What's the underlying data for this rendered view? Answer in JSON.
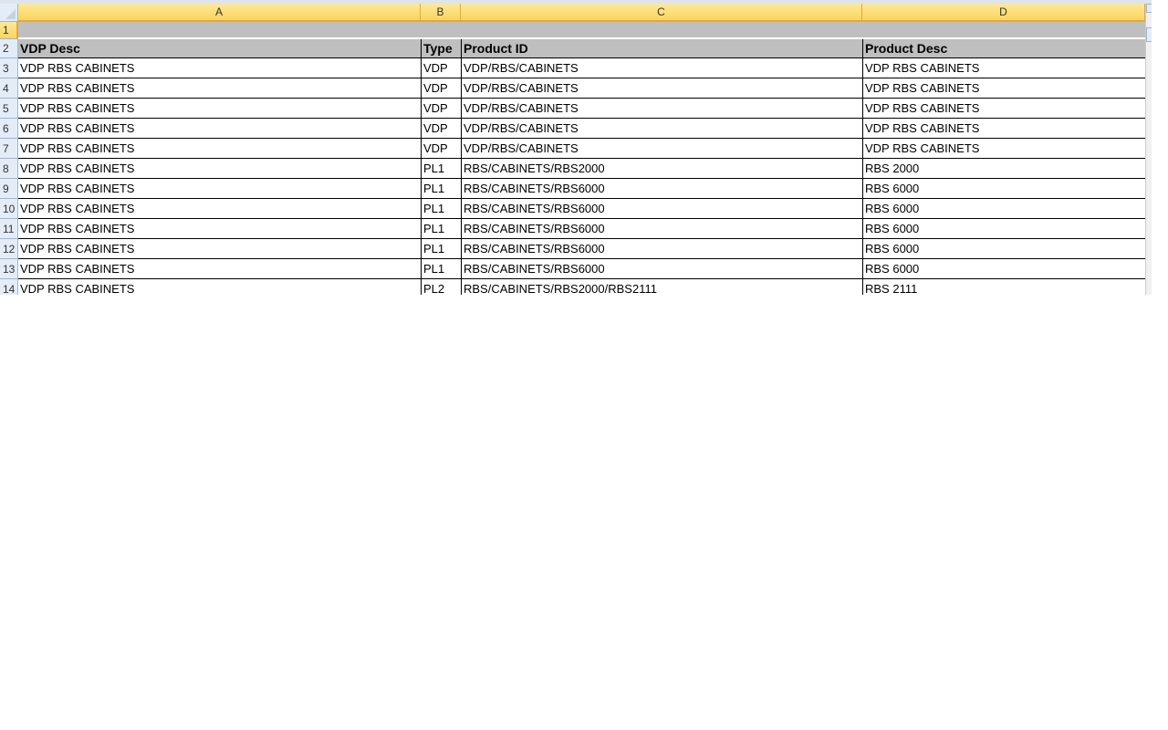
{
  "columns": [
    "A",
    "B",
    "C",
    "D"
  ],
  "row_numbers": [
    "1",
    "2",
    "3",
    "4",
    "5",
    "6",
    "7",
    "8",
    "9",
    "10",
    "11",
    "12",
    "13",
    "14"
  ],
  "header": [
    "VDP Desc",
    "Type",
    "Product ID",
    "Product Desc"
  ],
  "rows": [
    [
      "VDP RBS CABINETS",
      "VDP",
      "VDP/RBS/CABINETS",
      "VDP RBS CABINETS"
    ],
    [
      "VDP RBS CABINETS",
      "VDP",
      "VDP/RBS/CABINETS",
      "VDP RBS CABINETS"
    ],
    [
      "VDP RBS CABINETS",
      "VDP",
      "VDP/RBS/CABINETS",
      "VDP RBS CABINETS"
    ],
    [
      "VDP RBS CABINETS",
      "VDP",
      "VDP/RBS/CABINETS",
      "VDP RBS CABINETS"
    ],
    [
      "VDP RBS CABINETS",
      "VDP",
      "VDP/RBS/CABINETS",
      "VDP RBS CABINETS"
    ],
    [
      "VDP RBS CABINETS",
      "PL1",
      "RBS/CABINETS/RBS2000",
      "RBS 2000"
    ],
    [
      "VDP RBS CABINETS",
      "PL1",
      "RBS/CABINETS/RBS6000",
      "RBS 6000"
    ],
    [
      "VDP RBS CABINETS",
      "PL1",
      "RBS/CABINETS/RBS6000",
      "RBS 6000"
    ],
    [
      "VDP RBS CABINETS",
      "PL1",
      "RBS/CABINETS/RBS6000",
      "RBS 6000"
    ],
    [
      "VDP RBS CABINETS",
      "PL1",
      "RBS/CABINETS/RBS6000",
      "RBS 6000"
    ],
    [
      "VDP RBS CABINETS",
      "PL1",
      "RBS/CABINETS/RBS6000",
      "RBS 6000"
    ],
    [
      "VDP RBS CABINETS",
      "PL2",
      "RBS/CABINETS/RBS2000/RBS2111",
      "RBS 2111"
    ]
  ]
}
